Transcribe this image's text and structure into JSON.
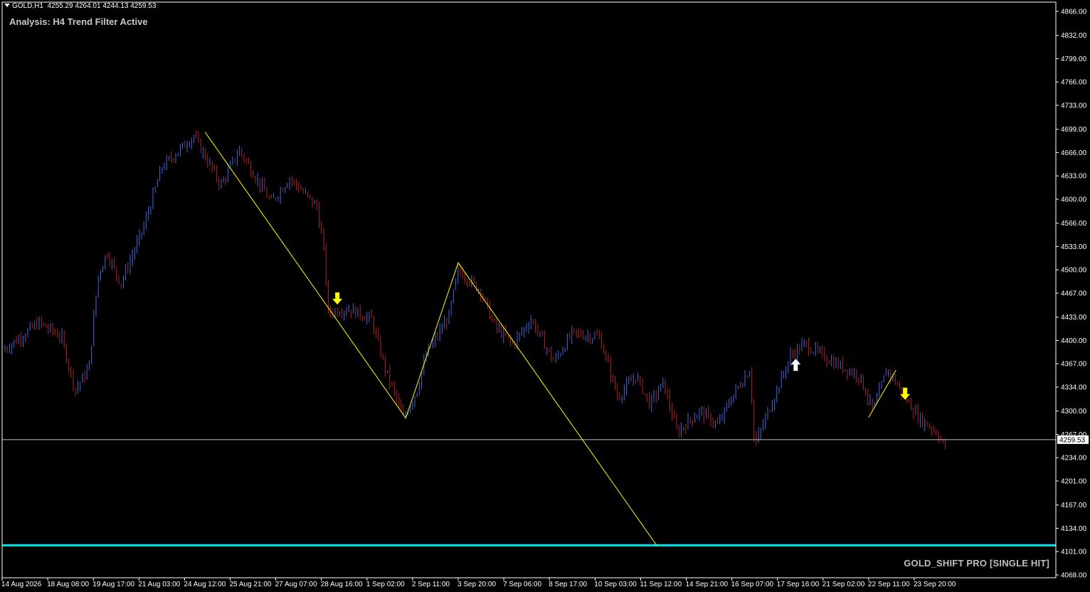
{
  "header": {
    "symbol": "GOLD,H1",
    "ohlc": "4255.29 4264.01 4244.13 4259.53"
  },
  "analysis_label": "Analysis: H4 Trend Filter Active",
  "brand_label": "GOLD_SHIFT PRO [SINGLE HIT]",
  "colors": {
    "background": "#000000",
    "bull": "#4169e1",
    "bear": "#b22222",
    "zigzag": "#ffff00",
    "support_line": "#00e5ee",
    "bid_line": "#c0c0c0",
    "axis_text": "#ffffff",
    "sell_arrow": "#ffff00",
    "buy_arrow": "#ffffff"
  },
  "chart_data": {
    "type": "candlestick-bars",
    "instrument": "GOLD",
    "timeframe": "H1",
    "y_ticks": [
      "4866.00",
      "4832.00",
      "4799.00",
      "4766.00",
      "4733.00",
      "4699.00",
      "4666.00",
      "4633.00",
      "4600.00",
      "4566.00",
      "4533.00",
      "4500.00",
      "4467.00",
      "4433.00",
      "4400.00",
      "4367.00",
      "4334.00",
      "4300.00",
      "4267.00",
      "4234.00",
      "4201.00",
      "4167.00",
      "4134.00",
      "4101.00",
      "4068.00"
    ],
    "ylim": [
      4068,
      4866
    ],
    "x_ticks": [
      "14 Aug 2026",
      "18 Aug 08:00",
      "19 Aug 17:00",
      "21 Aug 03:00",
      "24 Aug 12:00",
      "25 Aug 21:00",
      "27 Aug 07:00",
      "28 Aug 16:00",
      "1 Sep 02:00",
      "2 Sep 11:00",
      "3 Sep 20:00",
      "7 Sep 06:00",
      "8 Sep 17:00",
      "10 Sep 03:00",
      "11 Sep 12:00",
      "14 Sep 21:00",
      "16 Sep 07:00",
      "17 Sep 16:00",
      "21 Sep 02:00",
      "22 Sep 11:00",
      "23 Sep 20:00"
    ],
    "current_price": "4259.53",
    "price_path": [
      {
        "x": 0,
        "y": 4385
      },
      {
        "x": 0.8,
        "y": 4425
      },
      {
        "x": 1.3,
        "y": 4405
      },
      {
        "x": 1.6,
        "y": 4330
      },
      {
        "x": 1.9,
        "y": 4360
      },
      {
        "x": 2.1,
        "y": 4490
      },
      {
        "x": 2.3,
        "y": 4525
      },
      {
        "x": 2.6,
        "y": 4480
      },
      {
        "x": 3.1,
        "y": 4560
      },
      {
        "x": 3.5,
        "y": 4645
      },
      {
        "x": 4.2,
        "y": 4690
      },
      {
        "x": 4.8,
        "y": 4620
      },
      {
        "x": 5.2,
        "y": 4670
      },
      {
        "x": 5.9,
        "y": 4595
      },
      {
        "x": 6.3,
        "y": 4630
      },
      {
        "x": 6.9,
        "y": 4590
      },
      {
        "x": 7.05,
        "y": 4530
      },
      {
        "x": 7.15,
        "y": 4440
      },
      {
        "x": 7.6,
        "y": 4445
      },
      {
        "x": 8.1,
        "y": 4430
      },
      {
        "x": 8.4,
        "y": 4360
      },
      {
        "x": 8.8,
        "y": 4290
      },
      {
        "x": 9.1,
        "y": 4330
      },
      {
        "x": 9.3,
        "y": 4380
      },
      {
        "x": 9.8,
        "y": 4435
      },
      {
        "x": 10.0,
        "y": 4500
      },
      {
        "x": 10.5,
        "y": 4470
      },
      {
        "x": 10.8,
        "y": 4420
      },
      {
        "x": 11.2,
        "y": 4395
      },
      {
        "x": 11.6,
        "y": 4430
      },
      {
        "x": 12.1,
        "y": 4370
      },
      {
        "x": 12.5,
        "y": 4410
      },
      {
        "x": 13.1,
        "y": 4405
      },
      {
        "x": 13.5,
        "y": 4320
      },
      {
        "x": 13.9,
        "y": 4350
      },
      {
        "x": 14.2,
        "y": 4310
      },
      {
        "x": 14.5,
        "y": 4340
      },
      {
        "x": 14.8,
        "y": 4270
      },
      {
        "x": 15.3,
        "y": 4300
      },
      {
        "x": 15.7,
        "y": 4280
      },
      {
        "x": 16.0,
        "y": 4320
      },
      {
        "x": 16.4,
        "y": 4360
      },
      {
        "x": 16.5,
        "y": 4250
      },
      {
        "x": 16.8,
        "y": 4300
      },
      {
        "x": 17.3,
        "y": 4380
      },
      {
        "x": 17.6,
        "y": 4395
      },
      {
        "x": 18.2,
        "y": 4370
      },
      {
        "x": 18.8,
        "y": 4350
      },
      {
        "x": 19.1,
        "y": 4300
      },
      {
        "x": 19.4,
        "y": 4360
      },
      {
        "x": 19.8,
        "y": 4320
      },
      {
        "x": 20.1,
        "y": 4290
      },
      {
        "x": 20.5,
        "y": 4270
      },
      {
        "x": 20.65,
        "y": 4250
      }
    ],
    "zigzag": [
      {
        "x": 4.45,
        "y": 4695
      },
      {
        "x": 8.85,
        "y": 4290
      },
      {
        "x": 10.0,
        "y": 4510
      },
      {
        "x": 14.35,
        "y": 4110
      }
    ],
    "mini_zigzag": [
      {
        "x": 19.0,
        "y": 4291
      },
      {
        "x": 19.6,
        "y": 4358
      }
    ],
    "horizontal_lines": [
      {
        "name": "bid",
        "price": 4259.53
      },
      {
        "name": "support",
        "price": 4110
      }
    ],
    "signals": [
      {
        "type": "sell",
        "x": 7.35,
        "price": 4460
      },
      {
        "type": "buy",
        "x": 17.4,
        "price": 4365
      },
      {
        "type": "sell",
        "x": 19.8,
        "price": 4325
      }
    ]
  }
}
